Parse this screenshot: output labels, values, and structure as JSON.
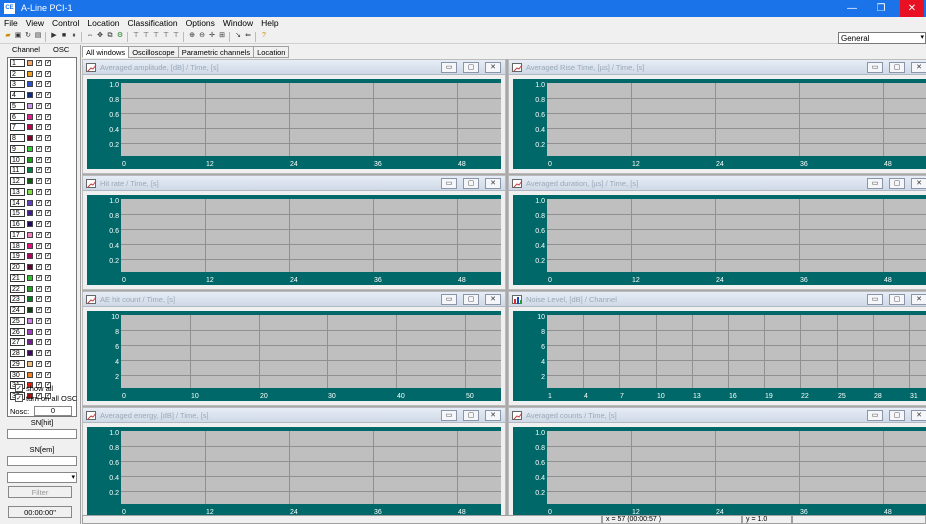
{
  "window": {
    "title": "A-Line PCI-1",
    "app_icon_text": "CE",
    "minimize": "—",
    "restore": "❐",
    "close": "✕"
  },
  "menu": [
    "File",
    "View",
    "Control",
    "Location",
    "Classification",
    "Options",
    "Window",
    "Help"
  ],
  "toolbar": {
    "combo_value": "General"
  },
  "left_panel": {
    "header_channel": "Channel",
    "header_osc": "OSC",
    "channels": [
      {
        "num": "1",
        "color": "#f4a56a"
      },
      {
        "num": "2",
        "color": "#f0a020"
      },
      {
        "num": "3",
        "color": "#2855c8"
      },
      {
        "num": "4",
        "color": "#102c80"
      },
      {
        "num": "5",
        "color": "#c899e8"
      },
      {
        "num": "6",
        "color": "#e0208c"
      },
      {
        "num": "7",
        "color": "#c00050"
      },
      {
        "num": "8",
        "color": "#800030"
      },
      {
        "num": "9",
        "color": "#30d030"
      },
      {
        "num": "10",
        "color": "#1aa01a"
      },
      {
        "num": "11",
        "color": "#008040"
      },
      {
        "num": "12",
        "color": "#105c10"
      },
      {
        "num": "13",
        "color": "#80e040"
      },
      {
        "num": "14",
        "color": "#6040c0"
      },
      {
        "num": "15",
        "color": "#402090"
      },
      {
        "num": "16",
        "color": "#200860"
      },
      {
        "num": "17",
        "color": "#f080c0"
      },
      {
        "num": "18",
        "color": "#e01080"
      },
      {
        "num": "19",
        "color": "#b00060"
      },
      {
        "num": "20",
        "color": "#600030"
      },
      {
        "num": "21",
        "color": "#30c030"
      },
      {
        "num": "22",
        "color": "#20a020"
      },
      {
        "num": "23",
        "color": "#008020"
      },
      {
        "num": "24",
        "color": "#104010"
      },
      {
        "num": "25",
        "color": "#d080e0"
      },
      {
        "num": "26",
        "color": "#a040c0"
      },
      {
        "num": "27",
        "color": "#702090"
      },
      {
        "num": "28",
        "color": "#400860"
      },
      {
        "num": "29",
        "color": "#f0c080"
      },
      {
        "num": "30",
        "color": "#f08020"
      },
      {
        "num": "31",
        "color": "#e02010"
      },
      {
        "num": "32",
        "color": "#a01010"
      }
    ],
    "show_all": "show all",
    "turn_on_all_osc": "turn on all OSC",
    "nosc_label": "Nosc:",
    "nosc_value": "0",
    "sn_hit_label": "SN[hit]",
    "sn_em_label": "SN[em]",
    "filter_button": "Filter",
    "timer_button": "00:00:00\""
  },
  "tabs": [
    "All windows",
    "Oscilloscope",
    "Parametric channels",
    "Location"
  ],
  "charts": [
    {
      "title": "Averaged amplitude, [dB] / Time, [s]",
      "icon": "line",
      "y": [
        "1.0",
        "0.8",
        "0.6",
        "0.4",
        "0.2"
      ],
      "x": [
        "0",
        "12",
        "24",
        "36",
        "48"
      ],
      "vgrid": 5
    },
    {
      "title": "Averaged Rise Time, [µs] / Time, [s]",
      "icon": "line",
      "y": [
        "1.0",
        "0.8",
        "0.6",
        "0.4",
        "0.2"
      ],
      "x": [
        "0",
        "12",
        "24",
        "36",
        "48"
      ],
      "vgrid": 5
    },
    {
      "title": "Hit rate / Time, [s]",
      "icon": "line",
      "y": [
        "1.0",
        "0.8",
        "0.6",
        "0.4",
        "0.2"
      ],
      "x": [
        "0",
        "12",
        "24",
        "36",
        "48"
      ],
      "vgrid": 5
    },
    {
      "title": "Averaged duration, [µs] / Time, [s]",
      "icon": "line",
      "y": [
        "1.0",
        "0.8",
        "0.6",
        "0.4",
        "0.2"
      ],
      "x": [
        "0",
        "12",
        "24",
        "36",
        "48"
      ],
      "vgrid": 5
    },
    {
      "title": "AE hit count / Time, [s]",
      "icon": "line",
      "y": [
        "10",
        "8",
        "6",
        "4",
        "2"
      ],
      "x": [
        "0",
        "10",
        "20",
        "30",
        "40",
        "50"
      ],
      "vgrid": 6
    },
    {
      "title": "Noise Level, [dB] / Channel",
      "icon": "bar",
      "y": [
        "10",
        "8",
        "6",
        "4",
        "2"
      ],
      "x": [
        "1",
        "4",
        "7",
        "10",
        "13",
        "16",
        "19",
        "22",
        "25",
        "28",
        "31"
      ],
      "vgrid": 11
    },
    {
      "title": "Averaged energy, [dB] / Time, [s]",
      "icon": "line",
      "y": [
        "1.0",
        "0.8",
        "0.6",
        "0.4",
        "0.2"
      ],
      "x": [
        "0",
        "12",
        "24",
        "36",
        "48"
      ],
      "vgrid": 5
    },
    {
      "title": "Averaged counts / Time, [s]",
      "icon": "line",
      "y": [
        "1.0",
        "0.8",
        "0.6",
        "0.4",
        "0.2"
      ],
      "x": [
        "0",
        "12",
        "24",
        "36",
        "48"
      ],
      "vgrid": 5
    }
  ],
  "status": {
    "x": "x = 57   (00:00:57 )",
    "y": "y = 1.0"
  }
}
